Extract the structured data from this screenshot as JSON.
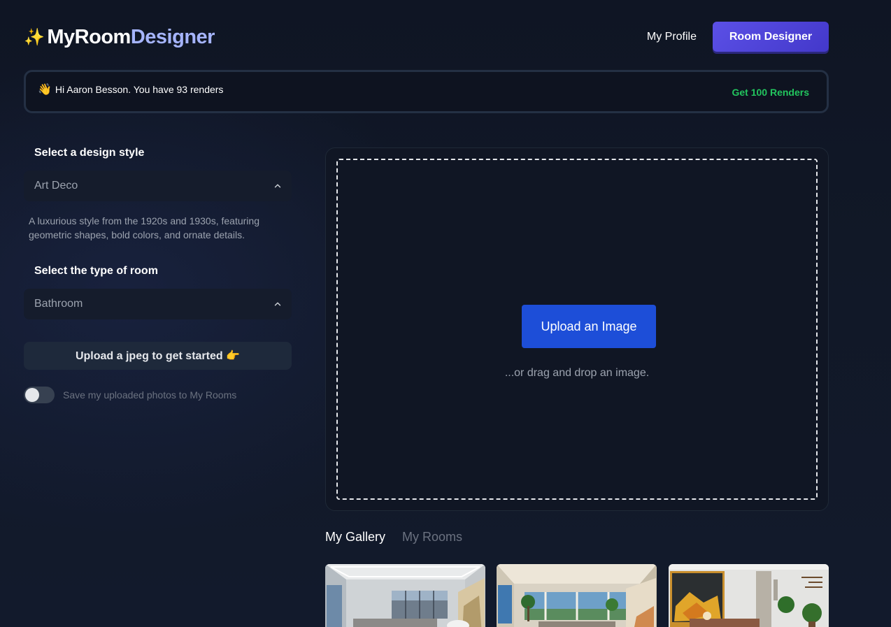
{
  "header": {
    "logo_sparkle": "✨",
    "logo_part1": "MyRoom",
    "logo_part2": "Designer",
    "nav_profile": "My Profile",
    "nav_room_designer": "Room Designer"
  },
  "banner": {
    "wave": "👋",
    "greeting": "Hi Aaron Besson. You have 93 renders",
    "cta": "Get 100 Renders"
  },
  "form": {
    "style_label": "Select a design style",
    "style_value": "Art Deco",
    "style_description": "A luxurious style from the 1920s and 1930s, featuring geometric shapes, bold colors, and ornate details.",
    "room_label": "Select the type of room",
    "room_value": "Bathroom",
    "upload_cta": "Upload a jpeg to get started 👉",
    "save_toggle_label": "Save my uploaded photos to My Rooms",
    "save_toggle_on": false
  },
  "dropzone": {
    "button": "Upload an Image",
    "hint": "...or drag and drop an image."
  },
  "tabs": [
    {
      "label": "My Gallery",
      "active": true
    },
    {
      "label": "My Rooms",
      "active": false
    }
  ],
  "gallery": [
    {
      "icon": "living-room-thumbnail"
    },
    {
      "icon": "sunroom-thumbnail"
    },
    {
      "icon": "bedroom-thumbnail"
    }
  ],
  "colors": {
    "brand_accent": "#a5b4fc",
    "primary_button": "#1d4ed8",
    "nav_button": "#4f46e5",
    "success": "#22c55e"
  }
}
